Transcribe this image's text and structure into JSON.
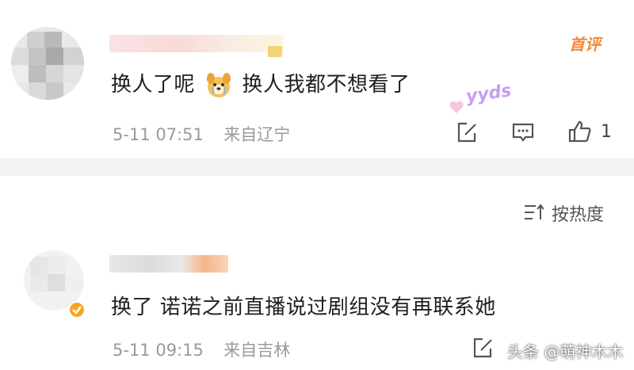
{
  "comments": [
    {
      "badge": "首评",
      "text_part1": "换人了呢",
      "text_part2": "换人我都不想看了",
      "emoji": "dog-cry-emoji",
      "sticker": "yyds",
      "date": "5-11 07:51",
      "location": "来自辽宁",
      "like_count": "1"
    },
    {
      "text": "换了 诺诺之前直播说过剧组没有再联系她",
      "date": "5-11 09:15",
      "location": "来自吉林"
    }
  ],
  "sort": {
    "label": "按热度"
  },
  "watermark": {
    "text": "头条 @萌神木木"
  },
  "colors": {
    "text": "#1f1f1f",
    "meta": "#9a9a9a",
    "badge": "#f08a3c",
    "divider": "#f2f2f2",
    "verified": "#f5a623"
  },
  "icons": [
    "share-icon",
    "comment-icon",
    "like-icon",
    "sort-icon",
    "verified-badge-icon"
  ]
}
